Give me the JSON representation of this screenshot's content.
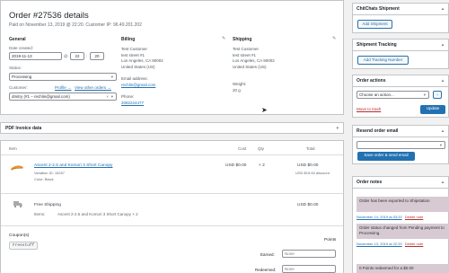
{
  "order": {
    "title": "Order #27536 details",
    "subtitle": "Paid on November 13, 2019 @ 22:20. Customer IP: 96.49.201.202"
  },
  "general": {
    "heading": "General",
    "date_label": "Date created:",
    "date_value": "2019-11-13",
    "at": "@",
    "hour": "22",
    "minute": "20",
    "status_label": "Status:",
    "status_value": "Processing",
    "customer_label": "Customer:",
    "profile_link": "Profile →",
    "view_orders_link": "View other orders →",
    "customer_value": "dmitry (#1 – rechlin@gmail.com)"
  },
  "billing": {
    "heading": "Billing",
    "address": [
      "Test Customer",
      "test street #1",
      "Los Angeles, CA 90002",
      "United States (US)"
    ],
    "email_label": "Email address:",
    "email": "rechlin@gmail.com",
    "phone_label": "Phone:",
    "phone": "2082224477"
  },
  "shipping": {
    "heading": "Shipping",
    "address": [
      "Test Customer",
      "test street #1",
      "Los Angeles, CA 90002",
      "United States (US)"
    ],
    "weight_label": "Weight:",
    "weight": "20 g"
  },
  "pdf": {
    "title": "PDF Invoice data"
  },
  "items": {
    "col_item": "Item",
    "col_cost": "Cost",
    "col_qty": "Qty",
    "col_total": "Total",
    "product_name": "Ascent 2-2.5 and Komori 3 Short Canopy",
    "variation_id": "Variation ID: 15287",
    "color": "Color: Black",
    "cost": "USD $0.00",
    "qty": "× 2",
    "total": "USD $0.00",
    "discount": "USD $15.60 discount",
    "shipping_name": "Free Shipping",
    "shipping_items_label": "Items:",
    "shipping_items": "Ascent 2-2.5 and Komori 3 Short Canopy × 2",
    "shipping_total": "USD $0.00"
  },
  "coupons": {
    "label": "Coupon(s)",
    "code": "Freestuff",
    "points_heading": "Points",
    "earned_label": "Earned:",
    "earned_value": "None",
    "redeemed_label": "Redeemed:",
    "redeemed_value": "None"
  },
  "sidebar": {
    "chitchats": {
      "title": "ChitChats Shipment",
      "button": "Add Shipment"
    },
    "tracking": {
      "title": "Shipment Tracking",
      "button": "Add Tracking Number"
    },
    "actions": {
      "title": "Order actions",
      "select": "Choose an action...",
      "trash": "Move to trash",
      "update": "Update"
    },
    "email": {
      "title": "Resend order email",
      "button": "Save order & send email"
    },
    "notes": {
      "title": "Order notes",
      "items": [
        {
          "text": "Order has been exported to Shipstation",
          "date": "November 14, 2019 at 03:20",
          "delete": "Delete note"
        },
        {
          "text": "Order status changed from Pending payment to Processing.",
          "date": "November 13, 2019 at 22:20",
          "delete": "Delete note"
        },
        {
          "text": "0 Points redeemed for a $0.00",
          "date": "",
          "delete": ""
        }
      ]
    }
  },
  "colors": {
    "accent": "#2271b1",
    "note_bg": "#d7cad2",
    "trash": "#b32d2e"
  }
}
